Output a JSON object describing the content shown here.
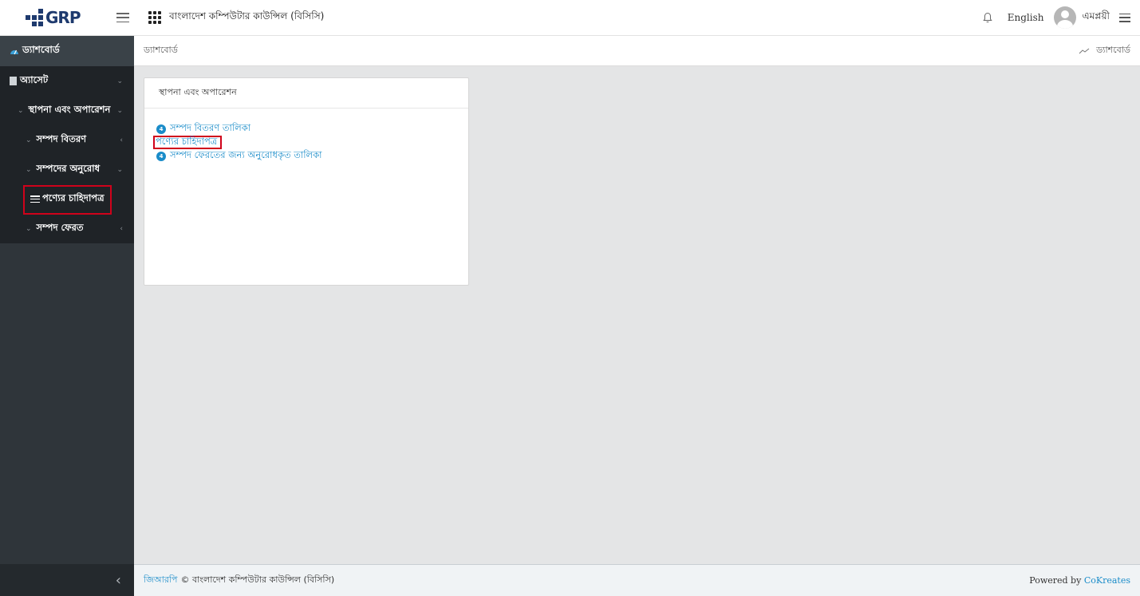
{
  "header": {
    "logo_text": "GRP",
    "org_name": "বাংলাদেশ কম্পিউটার কাউন্সিল (বিসিসি)",
    "language": "English",
    "user_name": "এমপ্লয়ী"
  },
  "sidebar": {
    "dashboard": "ড্যাশবোর্ড",
    "asset": "অ্যাসেট",
    "setup": "স্থাপনা এবং অপারেশন",
    "asset_distribution": "সম্পদ বিতরণ",
    "asset_request": "সম্পদের অনুরোধ",
    "product_requisition": "পণ্যের চাহিদাপত্র",
    "asset_return": "সম্পদ ফেরত",
    "collapse_icon": "chevron-left-icon"
  },
  "breadcrumb": {
    "current": "ড্যাশবোর্ড",
    "right_label": "ড্যাশবোর্ড"
  },
  "card": {
    "title": "স্থাপনা এবং অপারেশন",
    "links": [
      {
        "badge": "4",
        "label": "সম্পদ বিতরণ তালিকা"
      },
      {
        "label": "পণ্যের চাহিদাপত্র"
      },
      {
        "badge": "4",
        "label": "সম্পদ ফেরতের জন্য অনুরোধকৃত তালিকা"
      }
    ]
  },
  "footer": {
    "brand": "জিআরপি",
    "copyright": "© বাংলাদেশ কম্পিউটার কাউন্সিল (বিসিসি)",
    "powered_by": "Powered by",
    "vendor": "CoKreates"
  },
  "colors": {
    "accent": "#1a8cc9",
    "highlight": "#d0021b",
    "sidebar_bg": "#2f353a"
  }
}
